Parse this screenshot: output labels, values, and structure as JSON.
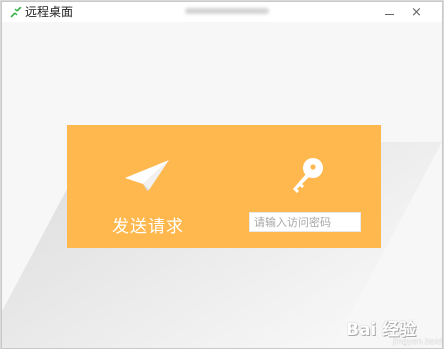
{
  "window": {
    "title": "远程桌面",
    "minimize_label": "",
    "close_label": "×"
  },
  "main": {
    "send_request_label": "发送请求",
    "access_code": {
      "value": "",
      "placeholder": "请输入访问密码"
    }
  },
  "watermark": {
    "text": "Bai 经验",
    "subtext": "jingyan.baidu.com"
  },
  "colors": {
    "accent": "#ffb84d",
    "app_icon": "#3bb34a"
  },
  "icons": {
    "app": "remote-desktop-icon",
    "send": "paper-plane-icon",
    "access": "key-icon"
  }
}
